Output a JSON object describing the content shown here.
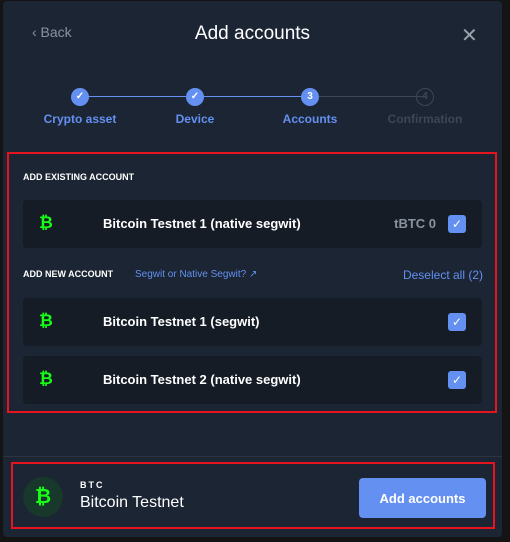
{
  "header": {
    "back_label": "‹ Back",
    "title": "Add accounts",
    "close_icon": "close-icon"
  },
  "stepper": {
    "steps": [
      {
        "label": "Crypto asset",
        "state": "done",
        "marker": "✓"
      },
      {
        "label": "Device",
        "state": "done",
        "marker": "✓"
      },
      {
        "label": "Accounts",
        "state": "active",
        "marker": "3"
      },
      {
        "label": "Confirmation",
        "state": "pending",
        "marker": "4"
      }
    ]
  },
  "existing": {
    "heading": "ADD EXISTING ACCOUNT",
    "accounts": [
      {
        "name": "Bitcoin Testnet 1 (native segwit)",
        "balance": "tBTC 0",
        "checked": true
      }
    ]
  },
  "new": {
    "heading": "ADD NEW ACCOUNT",
    "help_link": "Segwit or Native Segwit?",
    "deselect": "Deselect all (2)",
    "accounts": [
      {
        "name": "Bitcoin Testnet 1 (segwit)",
        "checked": true
      },
      {
        "name": "Bitcoin Testnet 2 (native segwit)",
        "checked": true
      }
    ]
  },
  "footer": {
    "ticker": "BTC",
    "coin_name": "Bitcoin Testnet",
    "add_button": "Add accounts"
  },
  "colors": {
    "accent": "#6490f1",
    "coin": "#16ff16",
    "background": "#1b2533",
    "annotation": "#e5141e"
  },
  "icons": {
    "coin": "₿",
    "check": "✓",
    "external": "↗"
  }
}
